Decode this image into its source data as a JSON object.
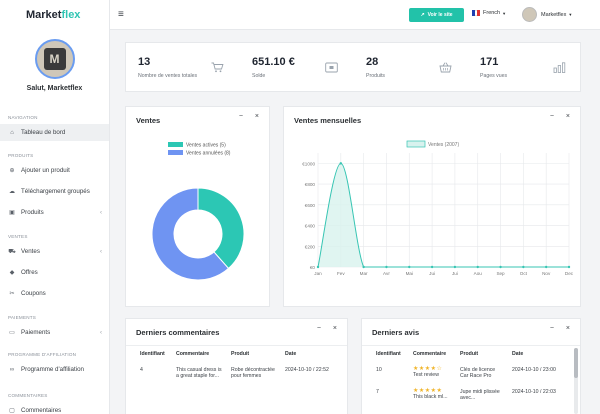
{
  "brand": {
    "part1": "Market",
    "part2": "flex"
  },
  "user": {
    "name": "Salut, Marketflex"
  },
  "sidebar": {
    "sections": [
      {
        "label": "NAVIGATION",
        "items": [
          {
            "label": "Tableau de bord",
            "icon": "home-icon",
            "chevron": false
          }
        ]
      },
      {
        "label": "PRODUITS",
        "items": [
          {
            "label": "Ajouter un produit",
            "icon": "add-circle-icon",
            "chevron": false
          },
          {
            "label": "Téléchargement groupés",
            "icon": "cloud-upload-icon",
            "chevron": false
          },
          {
            "label": "Produits",
            "icon": "box-icon",
            "chevron": true
          }
        ]
      },
      {
        "label": "VENTES",
        "items": [
          {
            "label": "Ventes",
            "icon": "cart-icon",
            "chevron": true
          },
          {
            "label": "Offres",
            "icon": "tag-icon",
            "chevron": false
          },
          {
            "label": "Coupons",
            "icon": "coupon-icon",
            "chevron": false
          }
        ]
      },
      {
        "label": "PAIEMENTS",
        "items": [
          {
            "label": "Paiements",
            "icon": "card-icon",
            "chevron": true
          }
        ]
      },
      {
        "label": "PROGRAMME D'AFFILIATION",
        "items": [
          {
            "label": "Programme d'affiliation",
            "icon": "link-icon",
            "chevron": false
          }
        ]
      },
      {
        "label": "COMMENTAIRES",
        "items": [
          {
            "label": "Commentaires",
            "icon": "comment-icon",
            "chevron": false
          }
        ]
      }
    ]
  },
  "topbar": {
    "visit_label": "Voir le site",
    "language": "French",
    "account": "Marketflex"
  },
  "stats": [
    {
      "value": "13",
      "label": "Nombre de ventes totales",
      "icon": "cart-icon"
    },
    {
      "value": "651.10 €",
      "label": "Solde",
      "icon": "wallet-icon"
    },
    {
      "value": "28",
      "label": "Produits",
      "icon": "basket-icon"
    },
    {
      "value": "171",
      "label": "Pages vues",
      "icon": "bar-chart-icon"
    }
  ],
  "panels": {
    "sales": {
      "title": "Ventes"
    },
    "monthly": {
      "title": "Ventes mensuelles"
    },
    "comments": {
      "title": "Derniers commentaires"
    },
    "reviews": {
      "title": "Derniers avis"
    }
  },
  "comments_table": {
    "headers": [
      "Identifiant",
      "Commentaire",
      "Produit",
      "Date"
    ],
    "rows": [
      {
        "id": "4",
        "comment": "This casual dress is a great staple for...",
        "product": "Robe décontractée pour femmes",
        "date": "2024-10-10 / 22:52"
      }
    ]
  },
  "reviews_table": {
    "headers": [
      "Identifiant",
      "Commentaire",
      "Produit",
      "Date"
    ],
    "rows": [
      {
        "id": "10",
        "rating": "★★★★☆",
        "comment": "Test review",
        "product": "Clés de licence Car Race Pro",
        "date": "2024-10-10 / 23:00"
      },
      {
        "id": "7",
        "rating": "★★★★★",
        "comment": "This black ml...",
        "product": "Jupe midi plissée avec...",
        "date": "2024-10-10 / 22:03"
      }
    ]
  },
  "chart_data": [
    {
      "type": "pie",
      "title": "",
      "legend": "top",
      "series": [
        {
          "name": "Ventes actives (5)",
          "value": 5,
          "color": "#2cc7b4"
        },
        {
          "name": "Ventes annulées (8)",
          "value": 8,
          "color": "#6f94f2"
        }
      ]
    },
    {
      "type": "area",
      "title": "",
      "legend": "top",
      "series": [
        {
          "name": "Ventes (2007)",
          "values": [
            0,
            1000,
            0,
            0,
            0,
            0,
            0,
            0,
            0,
            0,
            0,
            0
          ],
          "color": "#37c5b3"
        }
      ],
      "categories": [
        "Jan",
        "Fev",
        "Mar",
        "Avr",
        "Mai",
        "Jui",
        "Jui",
        "Aou",
        "Sep",
        "Oct",
        "Nov",
        "Dec"
      ],
      "ytick_labels": [
        "€0",
        "€200",
        "€400",
        "€600",
        "€800",
        "€1000"
      ],
      "ylim": [
        0,
        1100
      ],
      "grid": true
    }
  ]
}
